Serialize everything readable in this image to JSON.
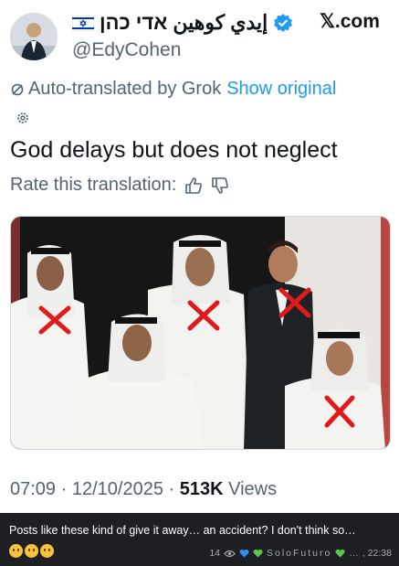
{
  "header": {
    "display_name": "إيدي كوهين אדי כהן",
    "handle": "@EdyCohen",
    "platform": "𝕏.com",
    "avatar_alt": "profile photo"
  },
  "translation": {
    "label": "Auto-translated by Grok",
    "show_original": "Show original",
    "rate_label": "Rate this translation:"
  },
  "tweet": {
    "text": "God delays but does not neglect",
    "time": "07:09",
    "date": "12/10/2025",
    "views_count": "513K",
    "views_label": "Views"
  },
  "chat": {
    "message": "Posts like these kind of give it away… an accident? I don't think so…",
    "view_count": "14",
    "sender": "SoloFuturo",
    "time": ", 22:38",
    "ellipsis": "…"
  },
  "colors": {
    "link": "#1d9bf0",
    "muted": "#536471",
    "verified": "#1d9bf0",
    "cross": "#e0191b",
    "chat_bg": "#1d1f23"
  },
  "icons": [
    "israel-flag-icon",
    "verified-badge-icon",
    "x-logo-icon",
    "translate-icon",
    "gear-icon",
    "thumbs-up-icon",
    "thumbs-down-icon",
    "eye-icon",
    "blue-heart-icon",
    "green-heart-icon"
  ]
}
